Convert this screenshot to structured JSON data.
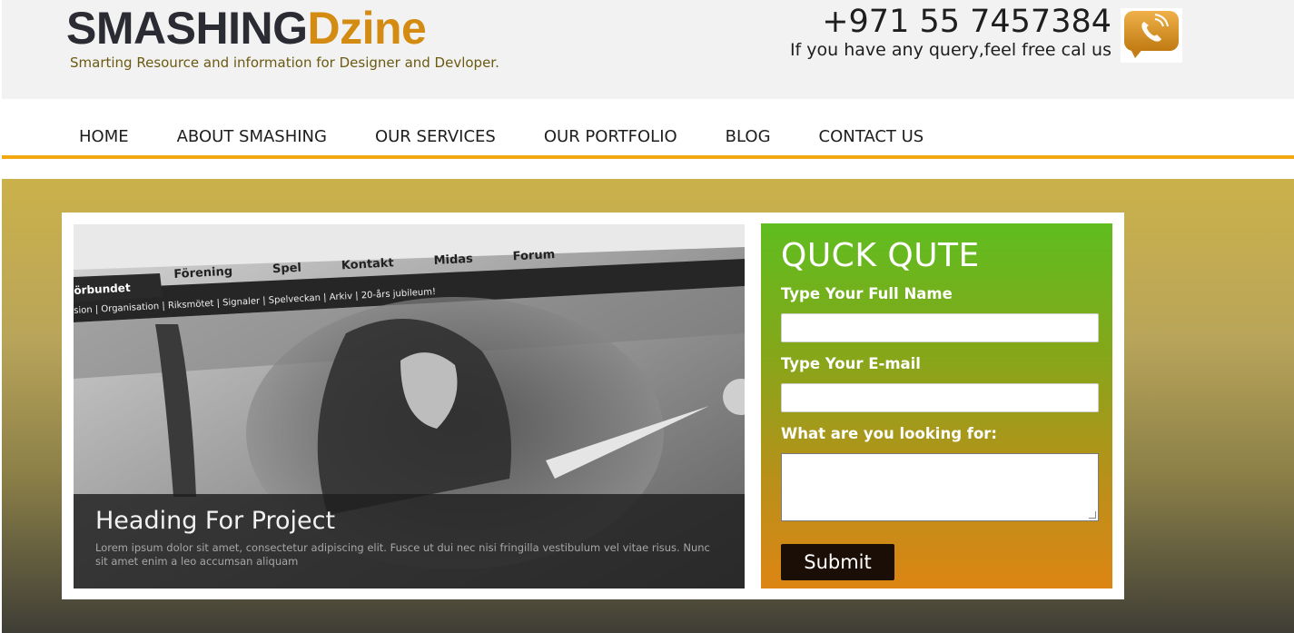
{
  "header": {
    "logo_part1": "SMASHING",
    "logo_part2": "Dzine",
    "tagline": "Smarting Resource and information for Designer and Devloper.",
    "phone": "+971 55 7457384",
    "query_text": "If you have any query,feel free cal us",
    "phone_icon": "phone-chat-icon"
  },
  "nav": {
    "items": [
      "HOME",
      "ABOUT SMASHING",
      "OUR SERVICES",
      "OUR PORTFOLIO",
      "BLOG",
      "CONTACT US"
    ]
  },
  "slider": {
    "site_tabs": [
      "Förening",
      "Spel",
      "Kontakt",
      "Midas",
      "Forum"
    ],
    "active_tab": "örbundet",
    "subnav": "sion | Organisation | Riksmötet | Signaler | Spelveckan | Arkiv | 20-års jubileum!",
    "heading": "Heading For Project",
    "text": "Lorem ipsum dolor sit amet, consectetur adipiscing elit. Fusce ut dui nec nisi fringilla vestibulum vel vitae risus. Nunc sit amet enim a leo accumsan aliquam"
  },
  "quote": {
    "title": "QUCK QUTE",
    "name_label": "Type Your Full Name",
    "email_label": "Type Your E-mail",
    "looking_label": "What are you looking for:",
    "name_value": "",
    "email_value": "",
    "looking_value": "",
    "submit_label": "Submit"
  },
  "colors": {
    "accent_orange": "#d38b12",
    "nav_underline": "#f3a712",
    "form_top": "#5fbd1f",
    "form_bottom": "#dd8513"
  }
}
